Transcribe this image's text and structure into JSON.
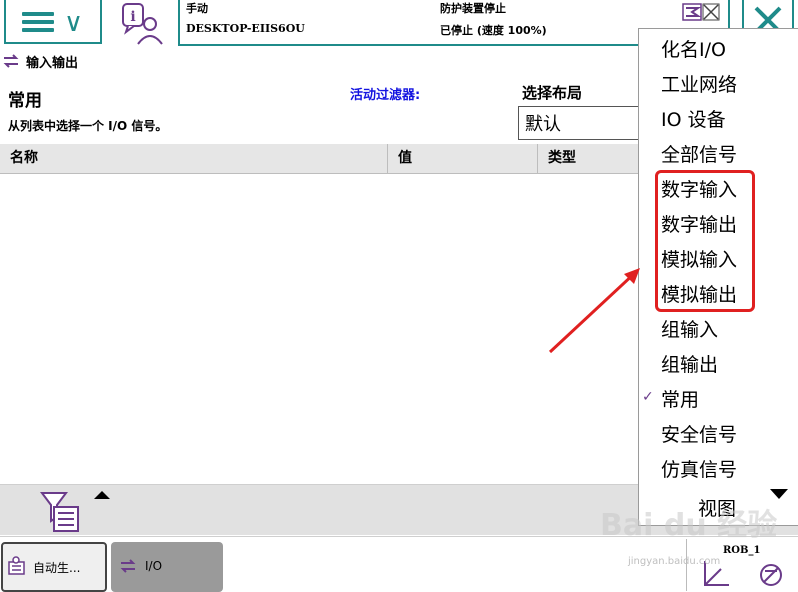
{
  "header": {
    "mode": "手动",
    "controller": "DESKTOP-EIIS6OU",
    "safety_state": "防护装置停止",
    "run_state": "已停止 (速度 100%)"
  },
  "page": {
    "title": "输入输出",
    "section_title": "常用",
    "instruction": "从列表中选择一个 I/O 信号。",
    "active_filter_label": "活动过滤器:",
    "select_layout_label": "选择布局",
    "layout_value": "默认"
  },
  "table": {
    "columns": [
      "名称",
      "值",
      "类型"
    ]
  },
  "dropdown": {
    "items": [
      {
        "label": "化名I/O"
      },
      {
        "label": "工业网络"
      },
      {
        "label": "IO 设备"
      },
      {
        "label": "全部信号"
      },
      {
        "label": "数字输入"
      },
      {
        "label": "数字输出"
      },
      {
        "label": "模拟输入"
      },
      {
        "label": "模拟输出"
      },
      {
        "label": "组输入"
      },
      {
        "label": "组输出"
      },
      {
        "label": "常用"
      },
      {
        "label": "安全信号"
      },
      {
        "label": "仿真信号"
      }
    ],
    "checked_item": "常用",
    "view_label": "视图"
  },
  "taskbar": {
    "tasks": [
      {
        "label": "自动生..."
      },
      {
        "label": "I/O"
      }
    ],
    "robot_label": "ROB_1"
  },
  "watermark": {
    "text": "Bai du 经验",
    "sub": "jingyan.baidu.com"
  },
  "colors": {
    "accent": "#1f8b8a",
    "filter_label": "#1414e0",
    "highlight": "#e02020"
  }
}
